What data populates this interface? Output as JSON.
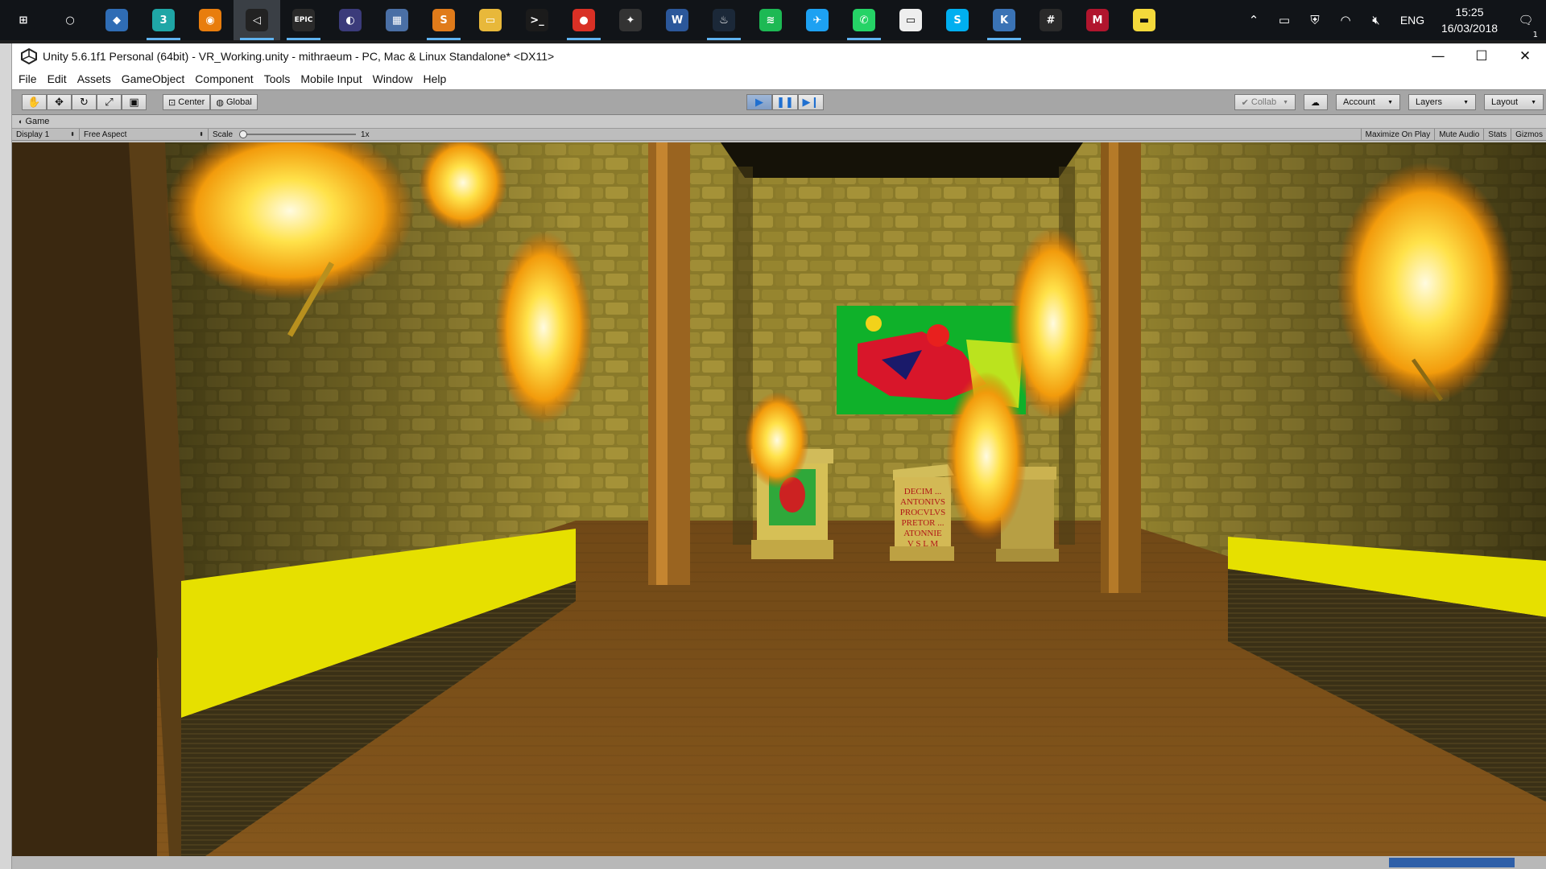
{
  "taskbar": {
    "apps": [
      {
        "name": "start-icon",
        "glyph": "⊞",
        "color": "#111418"
      },
      {
        "name": "cortana-icon",
        "glyph": "○",
        "color": "#111418"
      },
      {
        "name": "sourcetree-icon",
        "glyph": "◆",
        "color": "#2f6db5"
      },
      {
        "name": "3dsmax-icon",
        "glyph": "3",
        "color": "#1fa6a6"
      },
      {
        "name": "blender-icon",
        "glyph": "◉",
        "color": "#e87d0d"
      },
      {
        "name": "unity-icon",
        "glyph": "◁",
        "color": "#222"
      },
      {
        "name": "epic-games-icon",
        "glyph": "EPIC",
        "color": "#2a2a2a"
      },
      {
        "name": "eclipse-icon",
        "glyph": "◐",
        "color": "#3b3b7a"
      },
      {
        "name": "film-editor-icon",
        "glyph": "▦",
        "color": "#4a6fa5"
      },
      {
        "name": "sublime-text-icon",
        "glyph": "S",
        "color": "#e07b1a"
      },
      {
        "name": "file-explorer-icon",
        "glyph": "▭",
        "color": "#e8b83a"
      },
      {
        "name": "terminal-icon",
        "glyph": ">_",
        "color": "#1b1b1b"
      },
      {
        "name": "chrome-icon",
        "glyph": "●",
        "color": "#d93025"
      },
      {
        "name": "app-icon",
        "glyph": "✦",
        "color": "#333"
      },
      {
        "name": "word-icon",
        "glyph": "W",
        "color": "#2b579a"
      },
      {
        "name": "steam-icon",
        "glyph": "♨",
        "color": "#1b2838"
      },
      {
        "name": "spotify-icon",
        "glyph": "≋",
        "color": "#1db954"
      },
      {
        "name": "twitter-icon",
        "glyph": "✈",
        "color": "#1da1f2"
      },
      {
        "name": "whatsapp-icon",
        "glyph": "✆",
        "color": "#25d366"
      },
      {
        "name": "oculus-icon",
        "glyph": "▭",
        "color": "#eeeeee"
      },
      {
        "name": "skype-icon",
        "glyph": "S",
        "color": "#00aff0"
      },
      {
        "name": "krita-icon",
        "glyph": "K",
        "color": "#3a73b5"
      },
      {
        "name": "slack-icon",
        "glyph": "#",
        "color": "#2a2a2a"
      },
      {
        "name": "mendeley-icon",
        "glyph": "M",
        "color": "#b1152d"
      },
      {
        "name": "sticky-notes-icon",
        "glyph": "▬",
        "color": "#f4d93b"
      }
    ],
    "tray": {
      "language": "ENG",
      "time": "15:25",
      "date": "16/03/2018",
      "notification_count": "1"
    }
  },
  "window": {
    "title": "Unity 5.6.1f1 Personal (64bit) - VR_Working.unity - mithraeum - PC, Mac & Linux Standalone* <DX11>"
  },
  "menu": [
    "File",
    "Edit",
    "Assets",
    "GameObject",
    "Component",
    "Tools",
    "Mobile Input",
    "Window",
    "Help"
  ],
  "toolbar": {
    "pivot_mode": "Center",
    "pivot_rotation": "Global",
    "collab": "Collab",
    "account": "Account",
    "layers": "Layers",
    "layout": "Layout"
  },
  "game_view": {
    "tab": "Game",
    "display": "Display 1",
    "aspect": "Free Aspect",
    "scale_label": "Scale",
    "scale_value": "1x",
    "maximize": "Maximize On Play",
    "mute": "Mute Audio",
    "stats": "Stats",
    "gizmos": "Gizmos"
  },
  "scene": {
    "inscription_lines": [
      "DECIM ... ",
      "ANTONIVS",
      "PROCVLVS",
      "PRETOR ...",
      "ATONNIE",
      "V S L M"
    ]
  },
  "colors": {
    "play_blue": "#1f6fd0",
    "toolbar_gray": "#a6a6a6",
    "taskbar_bg": "#111418"
  }
}
